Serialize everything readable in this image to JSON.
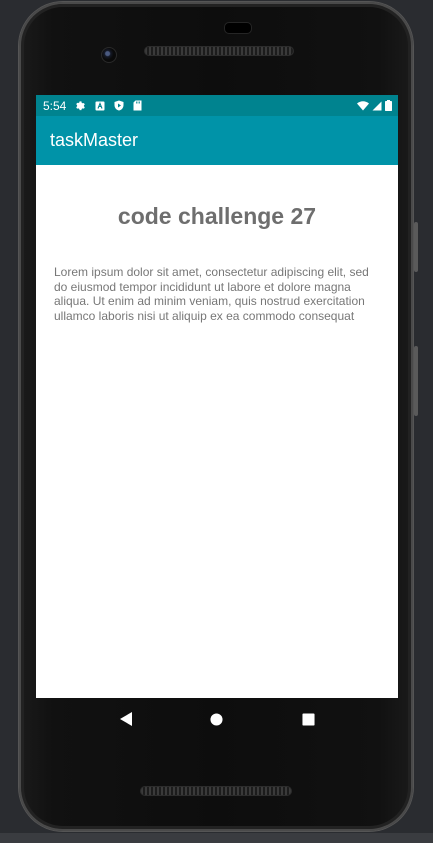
{
  "status_bar": {
    "time": "5:54",
    "left_icons": [
      "settings-icon",
      "font-a-icon",
      "shield-play-icon",
      "sd-card-icon"
    ],
    "right_icons": [
      "wifi-icon",
      "cell-signal-icon",
      "battery-icon"
    ]
  },
  "app_bar": {
    "title": "taskMaster"
  },
  "main": {
    "title": "code challenge 27",
    "body": "Lorem ipsum dolor sit amet, consectetur adipiscing elit, sed do eiusmod tempor incididunt ut labore et dolore magna aliqua. Ut enim ad minim veniam, quis nostrud exercitation ullamco laboris nisi ut aliquip ex ea commodo consequat"
  },
  "nav_bar": {
    "buttons": [
      "back-icon",
      "home-icon",
      "recents-icon"
    ]
  },
  "colors": {
    "status_bar": "#00838f",
    "app_bar": "#0093a8",
    "title_text": "#6e6e6e",
    "body_text": "#777777"
  }
}
